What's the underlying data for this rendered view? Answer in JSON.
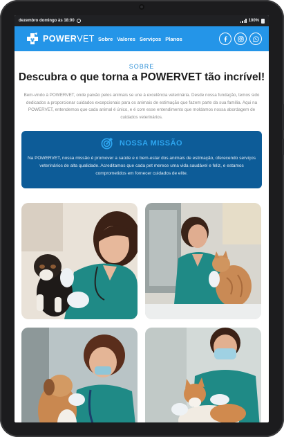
{
  "status_bar": {
    "datetime": "dezembro domingo às 18:00",
    "battery": "100%"
  },
  "brand": {
    "name_bold": "POWER",
    "name_light": "VET"
  },
  "nav": {
    "items": [
      {
        "label": "Sobre"
      },
      {
        "label": "Valores"
      },
      {
        "label": "Serviços"
      },
      {
        "label": "Planos"
      }
    ]
  },
  "socials": [
    {
      "icon": "facebook-icon"
    },
    {
      "icon": "instagram-icon"
    },
    {
      "icon": "whatsapp-icon"
    }
  ],
  "about": {
    "tag": "SOBRE",
    "title": "Descubra o que torna a POWERVET tão incrível!",
    "intro": "Bem-vindo à POWERVET, onde paixão pelos animais se une à excelência veterinária. Desde nossa fundação, temos sido dedicados a proporcionar cuidados excepcionais para os animais de estimação que fazem parte da sua família. Aqui na POWERVET, entendemos que cada animal é único, e é com esse entendimento que moldamos nossa abordagem de cuidados veterinários."
  },
  "mission": {
    "icon": "target-icon",
    "title": "NOSSA MISSÃO",
    "text": "Na POWERVET, nossa missão é promover a saúde e o bem-estar dos animais de estimação, oferecendo serviços veterinários de alta qualidade. Acreditamos que cada pet merece uma vida saudável e feliz, e estamos comprometidos em fornecer cuidados de elite."
  },
  "colors": {
    "navbar": "#2495e8",
    "mission_bg": "#0d5c98",
    "accent": "#2ea6f0",
    "scrub_teal": "#1f8a86"
  }
}
